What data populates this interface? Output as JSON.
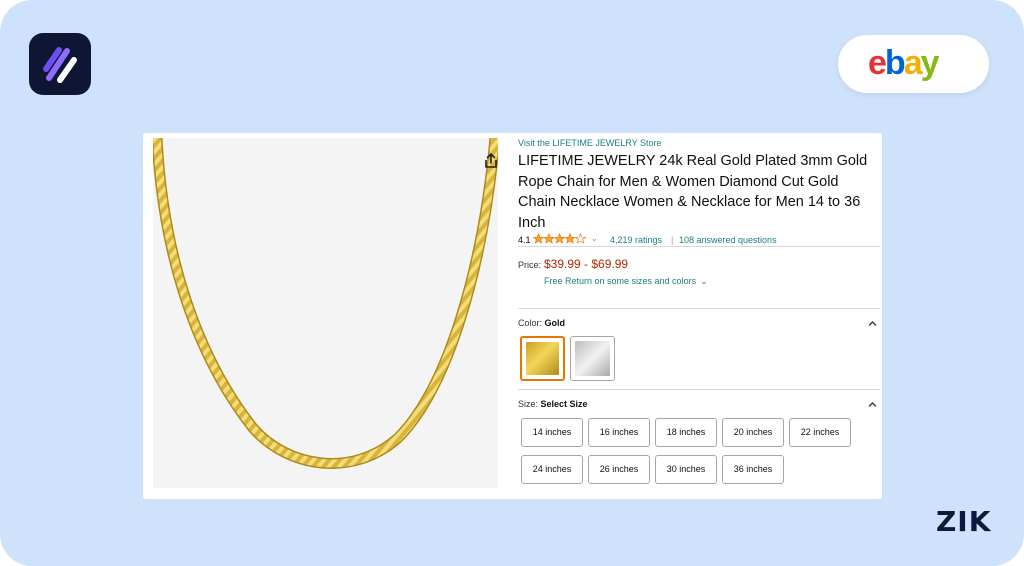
{
  "branding": {
    "app_logo_icon": "zik-stripes-logo-icon",
    "ebay_logo_text": "ebay",
    "ebay_colors": [
      "#e53238",
      "#0064d2",
      "#f5af02",
      "#86b817"
    ],
    "watermark": "ZIK"
  },
  "product": {
    "store_link": "Visit the LIFETIME JEWELRY Store",
    "title": "LIFETIME JEWELRY 24k Real Gold Plated 3mm Gold Rope Chain for Men & Women Diamond Cut Gold Chain Necklace Women & Necklace for Men 14 to 36 Inch",
    "rating_value": "4.1",
    "rating_stars": 4.1,
    "ratings_count": "4,219 ratings",
    "separator": "|",
    "answered_questions": "108 answered questions",
    "price_label": "Price:",
    "price_range": "$39.99 - $69.99",
    "free_return": "Free Return on some sizes and colors",
    "share_icon": "share-icon"
  },
  "color": {
    "label": "Color:",
    "selected": "Gold",
    "options": [
      "gold",
      "silver"
    ]
  },
  "size": {
    "label": "Size:",
    "selected": "Select Size",
    "options": [
      "14 inches",
      "16 inches",
      "18 inches",
      "20 inches",
      "22 inches",
      "24 inches",
      "26 inches",
      "30 inches",
      "36 inches"
    ]
  }
}
